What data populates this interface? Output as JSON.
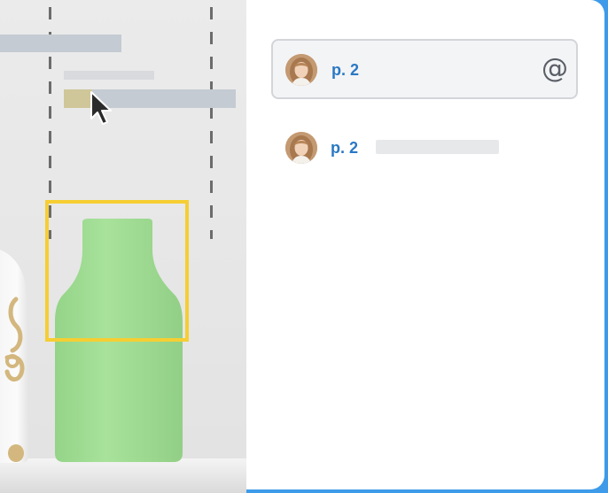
{
  "colors": {
    "frame_blue": "#3d9be9",
    "canvas_bg": "#e8e8e8",
    "selection_yellow": "#f6ce33",
    "vase_green": "#9fdc93",
    "page_ref_blue": "#2a78c4",
    "placeholder_gray": "#c5cbd2"
  },
  "icons": {
    "cursor": "arrow-pointer",
    "mention": "at-sign"
  },
  "mention_input": {
    "page_label": "p. 2",
    "at_symbol": "@"
  },
  "comment": {
    "page_label": "p. 2"
  }
}
